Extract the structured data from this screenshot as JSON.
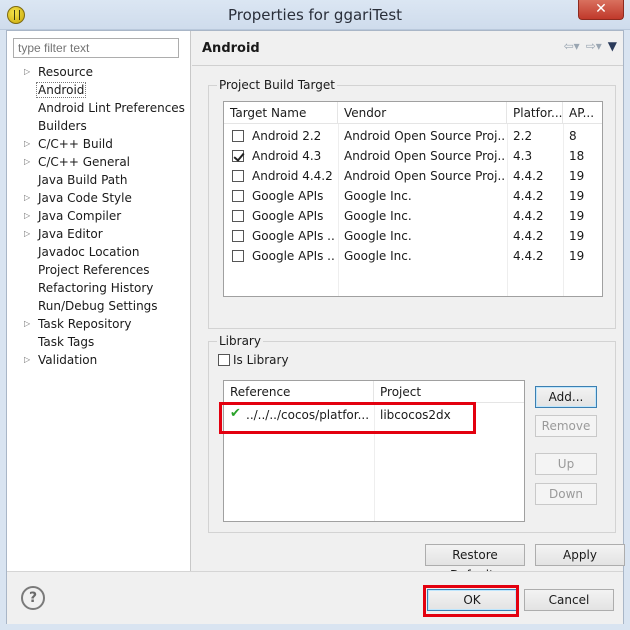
{
  "window": {
    "title": "Properties for ggariTest",
    "close": "✕"
  },
  "filter": {
    "placeholder": "type filter text"
  },
  "tree": [
    {
      "label": "Resource",
      "expandable": true
    },
    {
      "label": "Android",
      "expandable": false,
      "selected": true
    },
    {
      "label": "Android Lint Preferences",
      "expandable": false
    },
    {
      "label": "Builders",
      "expandable": false
    },
    {
      "label": "C/C++ Build",
      "expandable": true
    },
    {
      "label": "C/C++ General",
      "expandable": true
    },
    {
      "label": "Java Build Path",
      "expandable": false
    },
    {
      "label": "Java Code Style",
      "expandable": true
    },
    {
      "label": "Java Compiler",
      "expandable": true
    },
    {
      "label": "Java Editor",
      "expandable": true
    },
    {
      "label": "Javadoc Location",
      "expandable": false
    },
    {
      "label": "Project References",
      "expandable": false
    },
    {
      "label": "Refactoring History",
      "expandable": false
    },
    {
      "label": "Run/Debug Settings",
      "expandable": false
    },
    {
      "label": "Task Repository",
      "expandable": true
    },
    {
      "label": "Task Tags",
      "expandable": false
    },
    {
      "label": "Validation",
      "expandable": true
    }
  ],
  "page": {
    "title": "Android"
  },
  "build_target": {
    "group_label": "Project Build Target",
    "columns": [
      "Target Name",
      "Vendor",
      "Platfor...",
      "AP..."
    ],
    "rows": [
      {
        "name": "Android 2.2",
        "vendor": "Android Open Source Proj...",
        "platform": "2.2",
        "api": "8",
        "checked": false
      },
      {
        "name": "Android 4.3",
        "vendor": "Android Open Source Proj...",
        "platform": "4.3",
        "api": "18",
        "checked": true
      },
      {
        "name": "Android 4.4.2",
        "vendor": "Android Open Source Proj...",
        "platform": "4.4.2",
        "api": "19",
        "checked": false
      },
      {
        "name": "Google APIs",
        "vendor": "Google Inc.",
        "platform": "4.4.2",
        "api": "19",
        "checked": false
      },
      {
        "name": "Google APIs",
        "vendor": "Google Inc.",
        "platform": "4.4.2",
        "api": "19",
        "checked": false
      },
      {
        "name": "Google APIs ...",
        "vendor": "Google Inc.",
        "platform": "4.4.2",
        "api": "19",
        "checked": false
      },
      {
        "name": "Google APIs ...",
        "vendor": "Google Inc.",
        "platform": "4.4.2",
        "api": "19",
        "checked": false
      }
    ]
  },
  "library": {
    "group_label": "Library",
    "is_library_label": "Is Library",
    "is_library_checked": false,
    "columns": [
      "Reference",
      "Project"
    ],
    "rows": [
      {
        "reference": "../../../cocos/platfor...",
        "project": "libcocos2dx",
        "status_icon": "green-check-icon"
      }
    ],
    "buttons": {
      "add": "Add...",
      "remove": "Remove",
      "up": "Up",
      "down": "Down"
    }
  },
  "footer_buttons": {
    "restore_defaults": "Restore Defaults",
    "apply": "Apply"
  },
  "dialog_buttons": {
    "ok": "OK",
    "cancel": "Cancel",
    "help": "?"
  },
  "colors": {
    "highlight": "#e3000f",
    "check": "#2aa22a",
    "close_button": "#c0392b"
  }
}
